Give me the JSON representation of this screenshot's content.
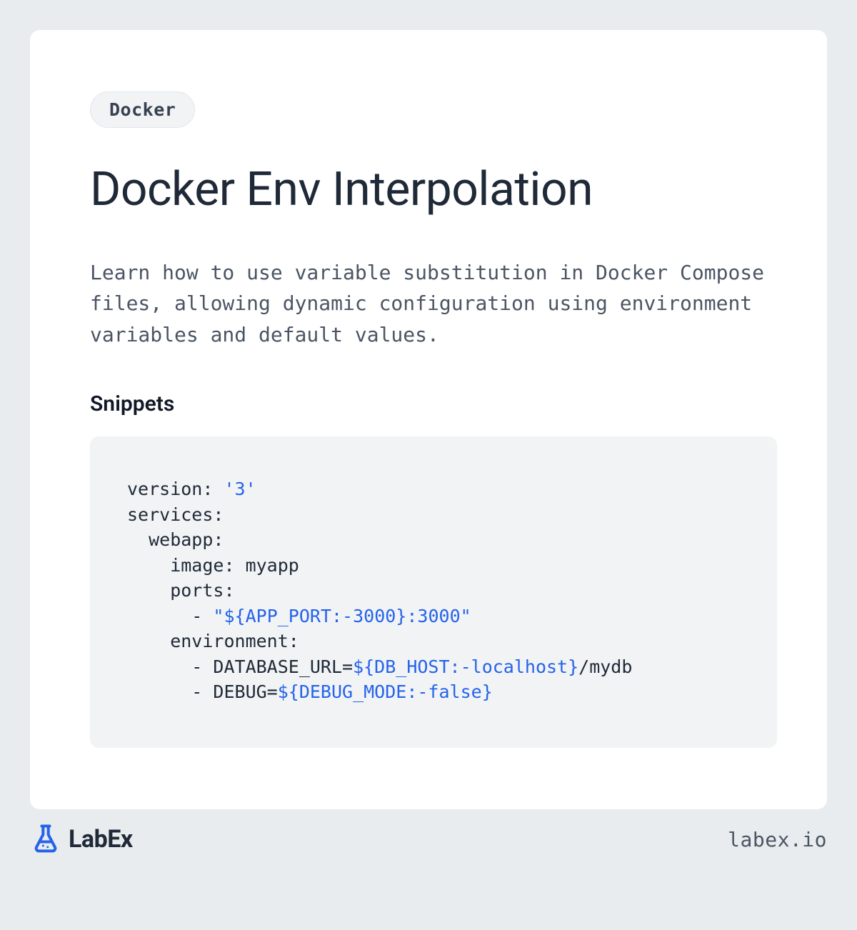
{
  "tag": "Docker",
  "title": "Docker Env Interpolation",
  "description": "Learn how to use variable substitution in Docker Compose files, allowing dynamic configuration using environment variables and default values.",
  "snippets_heading": "Snippets",
  "code": {
    "l1a": "version: ",
    "l1b": "'3'",
    "l2": "services:",
    "l3": "  webapp:",
    "l4": "    image: myapp",
    "l5": "    ports:",
    "l6a": "      - ",
    "l6b": "\"",
    "l6c": "${APP_PORT:-3000}",
    "l6d": ":3000\"",
    "l7": "    environment:",
    "l8a": "      - DATABASE_URL=",
    "l8b": "${DB_HOST:-localhost}",
    "l8c": "/mydb",
    "l9a": "      - DEBUG=",
    "l9b": "${DEBUG_MODE:-false}"
  },
  "footer": {
    "brand": "LabEx",
    "site": "labex.io"
  }
}
